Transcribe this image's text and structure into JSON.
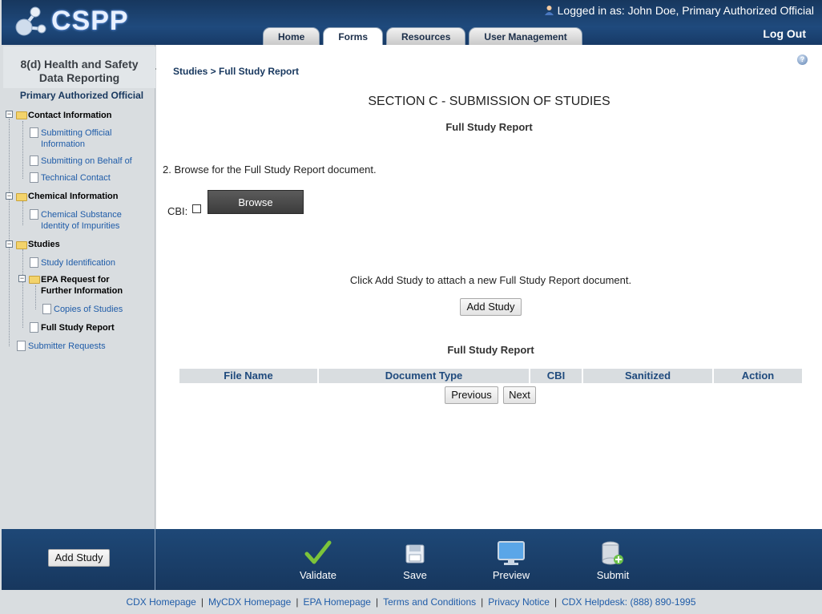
{
  "header": {
    "logo_text": "CSPP",
    "logged_in": "Logged in as: John Doe, Primary Authorized Official",
    "tabs": [
      "Home",
      "Forms",
      "Resources",
      "User Management"
    ],
    "active_tab": "Forms",
    "logout": "Log Out"
  },
  "sidebar": {
    "title_line1": "8(d) Health and Safety",
    "title_line2": "Data Reporting",
    "role": "Primary Authorized Official",
    "items": [
      {
        "label": "Contact Information"
      },
      {
        "label": "Submitting Official Information"
      },
      {
        "label": "Submitting on Behalf of"
      },
      {
        "label": "Technical Contact"
      },
      {
        "label": "Chemical Information"
      },
      {
        "label": "Chemical Substance Identity of Impurities"
      },
      {
        "label": "Studies"
      },
      {
        "label": "Study Identification"
      },
      {
        "label": "EPA Request for Further Information"
      },
      {
        "label": "Copies of Studies"
      },
      {
        "label": "Full Study Report"
      },
      {
        "label": "Submitter Requests"
      }
    ]
  },
  "main": {
    "breadcrumb": "Studies > Full Study Report",
    "section_title": "SECTION C - SUBMISSION OF STUDIES",
    "sub_title": "Full Study Report",
    "instruction": "2. Browse for the Full Study Report document.",
    "cbi_label": "CBI:",
    "browse_label": "Browse",
    "attach_text": "Click Add Study to attach a new Full Study Report document.",
    "add_study_label": "Add Study",
    "table_title": "Full Study Report",
    "columns": [
      "File Name",
      "Document Type",
      "CBI",
      "Sanitized",
      "Action"
    ],
    "prev_label": "Previous",
    "next_label": "Next",
    "help_icon": "help-icon"
  },
  "footer": {
    "add_study_label": "Add Study",
    "actions": [
      "Validate",
      "Save",
      "Preview",
      "Submit"
    ],
    "links": [
      "CDX Homepage",
      "MyCDX Homepage",
      "EPA Homepage",
      "Terms and Conditions",
      "Privacy Notice",
      "CDX Helpdesk: (888) 890-1995"
    ]
  },
  "colors": {
    "header_bg": "#1f4a7d",
    "link": "#1f5ca8",
    "nav_text": "#17375e"
  }
}
